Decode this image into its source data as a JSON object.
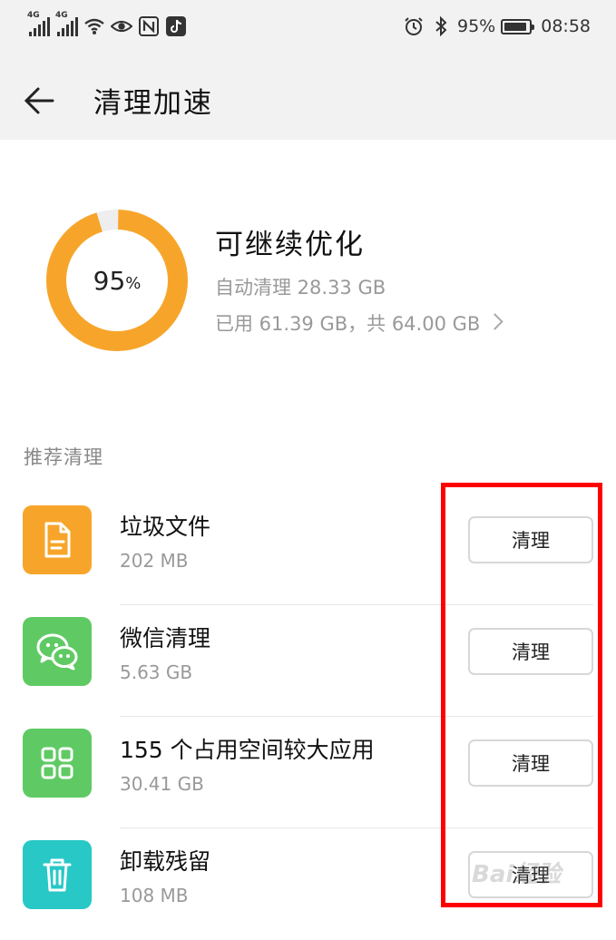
{
  "status_bar": {
    "signal1": "4G",
    "signal2": "4G",
    "battery": "95%",
    "time": "08:58"
  },
  "header": {
    "title": "清理加速"
  },
  "storage": {
    "percent": "95",
    "percent_unit": "%",
    "percent_value": 0.95,
    "title": "可继续优化",
    "auto_clean": "自动清理 28.33 GB",
    "used": "已用 61.39 GB，共 64.00 GB",
    "ring_color": "#f7a52a"
  },
  "section_label": "推荐清理",
  "items": [
    {
      "name": "垃圾文件",
      "size": "202 MB",
      "button": "清理",
      "icon": "document-icon",
      "color": "#f7a52a"
    },
    {
      "name": "微信清理",
      "size": "5.63 GB",
      "button": "清理",
      "icon": "wechat-icon",
      "color": "#5fca63"
    },
    {
      "name": "155 个占用空间较大应用",
      "size": "30.41 GB",
      "button": "清理",
      "icon": "apps-grid-icon",
      "color": "#5fca63"
    },
    {
      "name": "卸载残留",
      "size": "108 MB",
      "button": "清理",
      "icon": "trash-icon",
      "color": "#27c8c6"
    }
  ],
  "watermark": "Bai经验"
}
